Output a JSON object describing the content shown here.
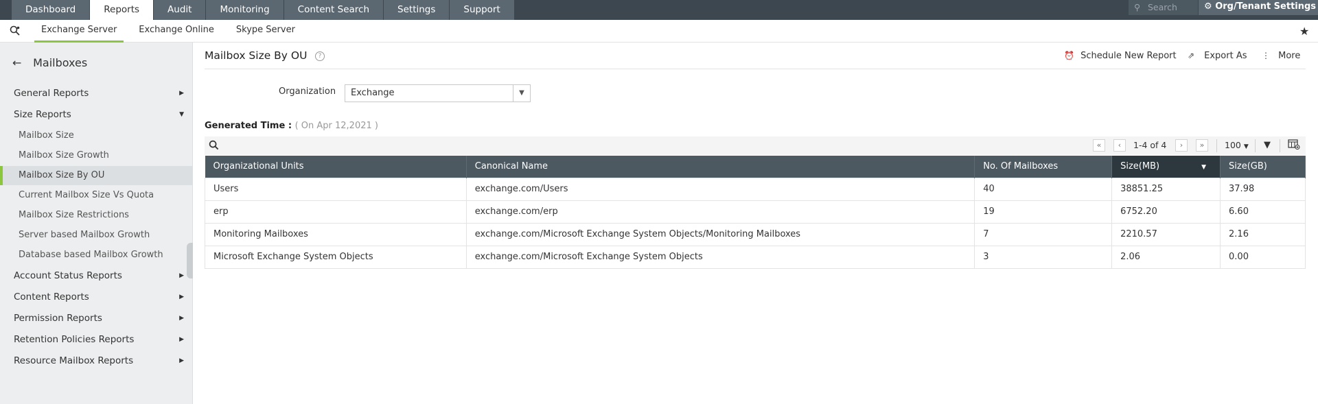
{
  "topnav": {
    "tabs": [
      "Dashboard",
      "Reports",
      "Audit",
      "Monitoring",
      "Content Search",
      "Settings",
      "Support"
    ],
    "active_tab": "Reports",
    "search_placeholder": "Search",
    "org_settings_label": "Org/Tenant Settings"
  },
  "subnav": {
    "tabs": [
      "Exchange Server",
      "Exchange Online",
      "Skype Server"
    ],
    "active_tab": "Exchange Server"
  },
  "sidebar": {
    "title": "Mailboxes",
    "categories": [
      "General Reports",
      "Size Reports",
      "Account Status Reports",
      "Content Reports",
      "Permission Reports",
      "Retention Policies Reports",
      "Resource Mailbox Reports"
    ],
    "expanded": "Size Reports",
    "size_reports": [
      "Mailbox Size",
      "Mailbox Size Growth",
      "Mailbox Size By OU",
      "Current Mailbox Size Vs Quota",
      "Mailbox Size Restrictions",
      "Server based Mailbox Growth",
      "Database based Mailbox Growth"
    ],
    "active_item": "Mailbox Size By OU"
  },
  "report": {
    "title": "Mailbox Size By OU",
    "actions": {
      "schedule": "Schedule New Report",
      "export": "Export As",
      "more": "More"
    },
    "organization_label": "Organization",
    "organization_value": "Exchange",
    "generated_label": "Generated Time :",
    "generated_value": "( On Apr 12,2021 )"
  },
  "pager": {
    "range": "1-4 of 4",
    "page_size": "100"
  },
  "table": {
    "columns": [
      "Organizational Units",
      "Canonical Name",
      "No. Of Mailboxes",
      "Size(MB)",
      "Size(GB)"
    ],
    "sorted_column": "Size(MB)",
    "rows": [
      [
        "Users",
        "exchange.com/Users",
        "40",
        "38851.25",
        "37.98"
      ],
      [
        "erp",
        "exchange.com/erp",
        "19",
        "6752.20",
        "6.60"
      ],
      [
        "Monitoring Mailboxes",
        "exchange.com/Microsoft Exchange System Objects/Monitoring Mailboxes",
        "7",
        "2210.57",
        "2.16"
      ],
      [
        "Microsoft Exchange System Objects",
        "exchange.com/Microsoft Exchange System Objects",
        "3",
        "2.06",
        "0.00"
      ]
    ]
  },
  "colors": {
    "topbar": "#3c474f",
    "accent_green": "#8cc63f",
    "table_header": "#4d5961"
  }
}
